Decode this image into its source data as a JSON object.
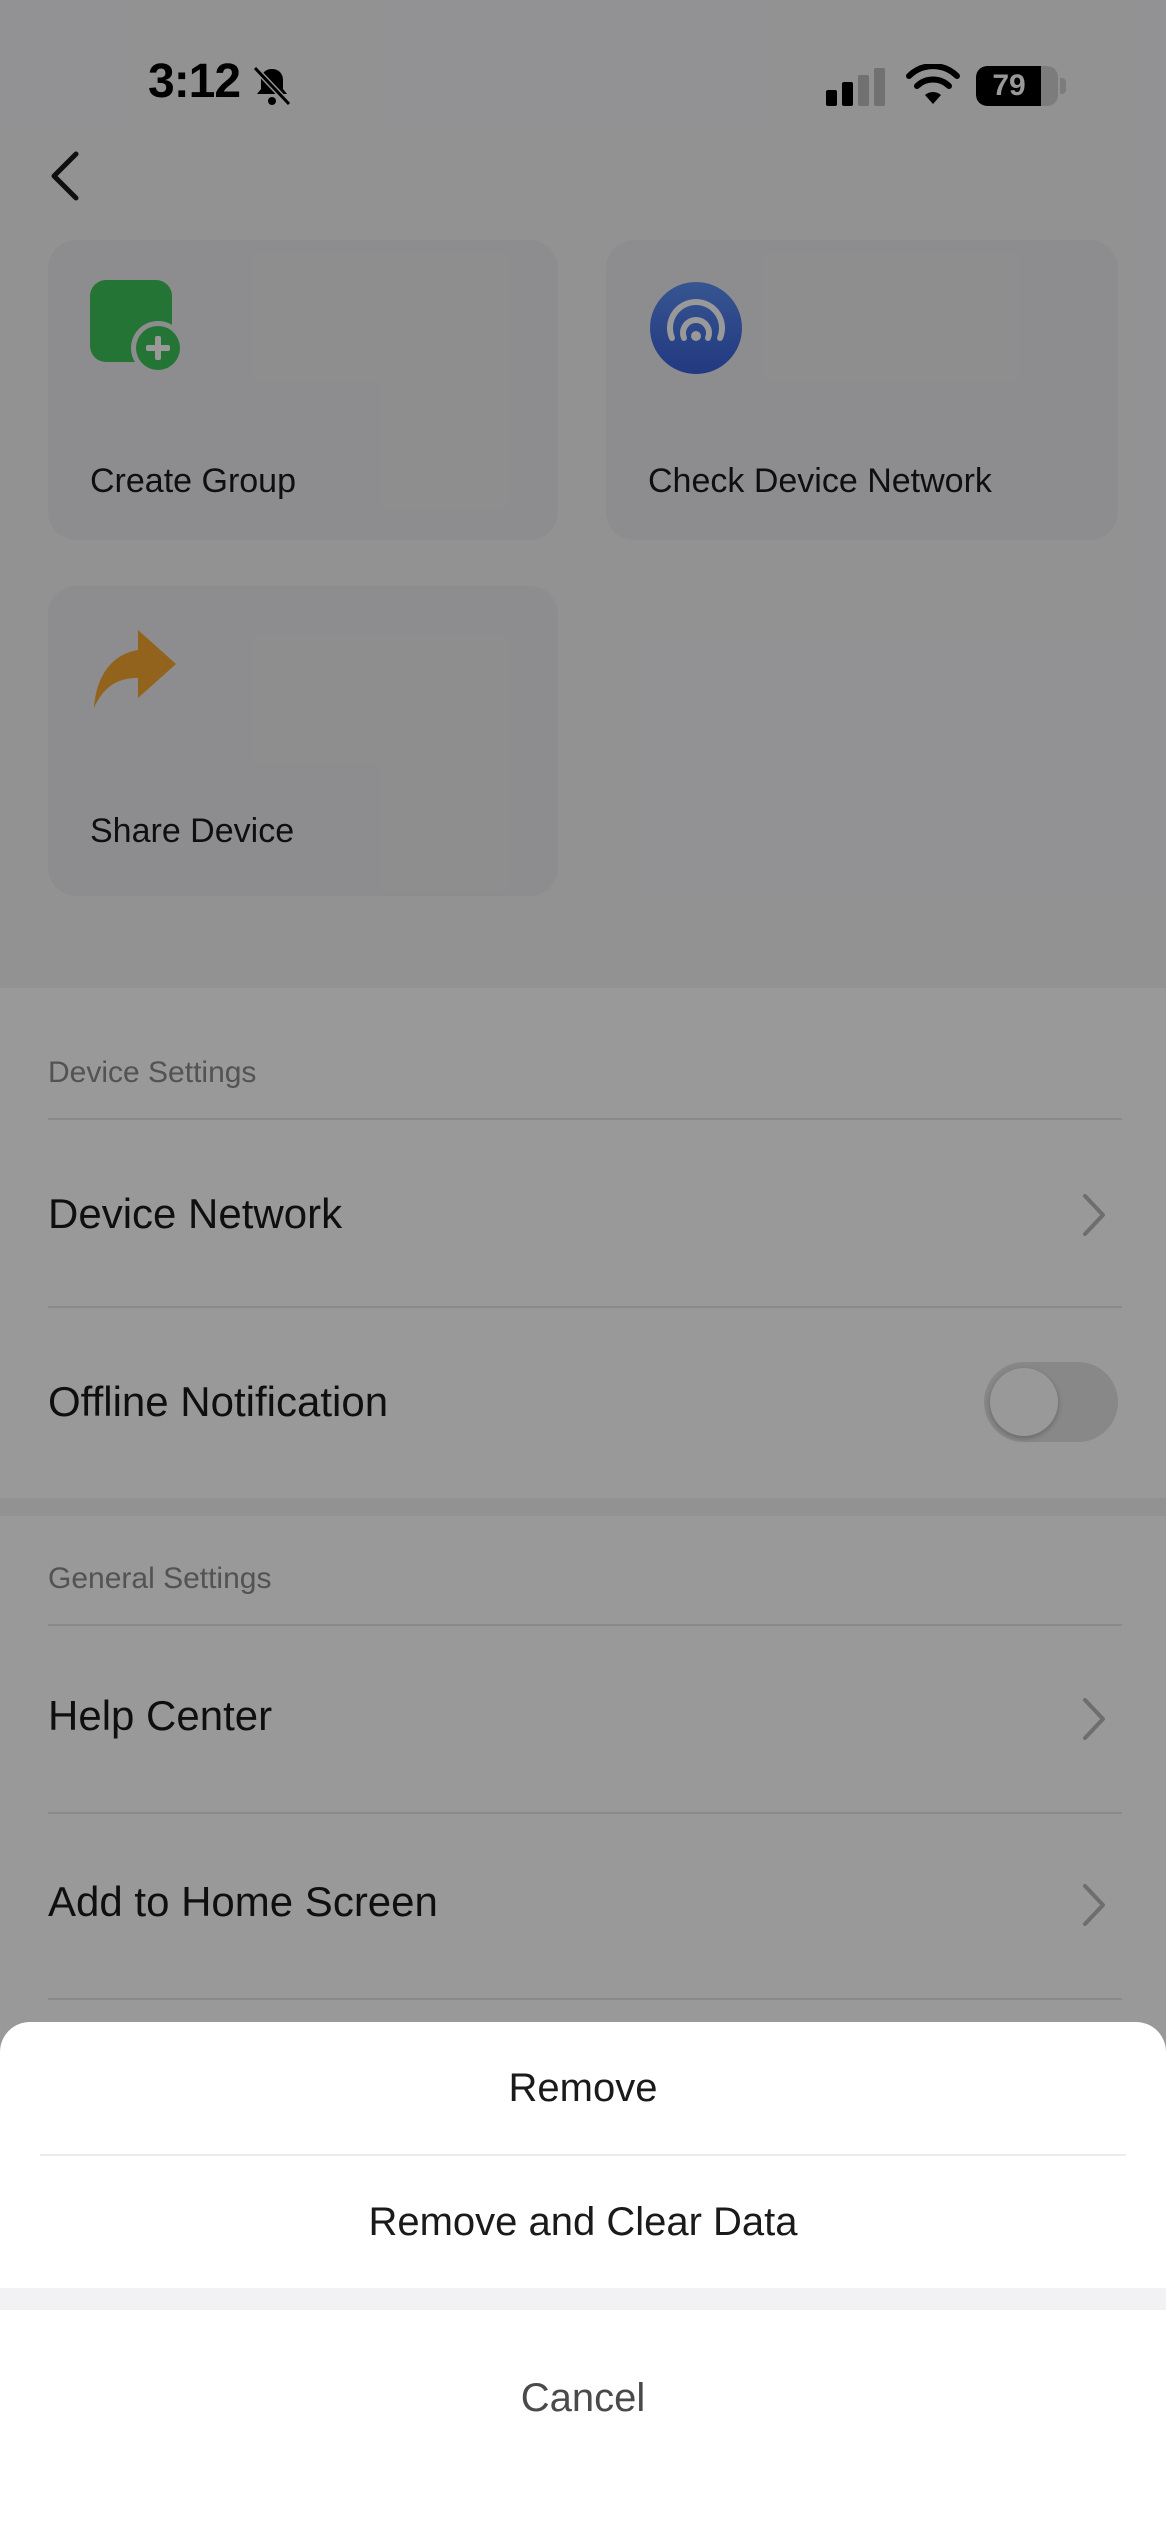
{
  "status_bar": {
    "time": "3:12",
    "battery": "79",
    "battery_level": 0.79,
    "icons": [
      "bell-slash-icon",
      "cellular-signal-icon",
      "wifi-icon",
      "battery-icon"
    ]
  },
  "nav": {
    "back_icon": "chevron-left-icon"
  },
  "actions": [
    {
      "label": "Create Group",
      "icon": "create-group-icon",
      "color": "#3cc25a"
    },
    {
      "label": "Check Device Network",
      "icon": "network-check-icon",
      "color": "#4a76e6"
    },
    {
      "label": "Share Device",
      "icon": "share-arrow-icon",
      "color": "#f4a531"
    }
  ],
  "device_settings": {
    "header": "Device Settings",
    "items": [
      {
        "label": "Device Network",
        "control": "chevron"
      },
      {
        "label": "Offline Notification",
        "control": "toggle",
        "on": false
      }
    ]
  },
  "general_settings": {
    "header": "General Settings",
    "items": [
      {
        "label": "Help Center",
        "control": "chevron"
      },
      {
        "label": "Add to Home Screen",
        "control": "chevron"
      }
    ]
  },
  "action_sheet": {
    "options": [
      "Remove",
      "Remove and Clear Data"
    ],
    "cancel": "Cancel"
  },
  "colors": {
    "overlay": "rgba(0,0,0,0.4)",
    "toggle_off": "#e3e3e5"
  }
}
